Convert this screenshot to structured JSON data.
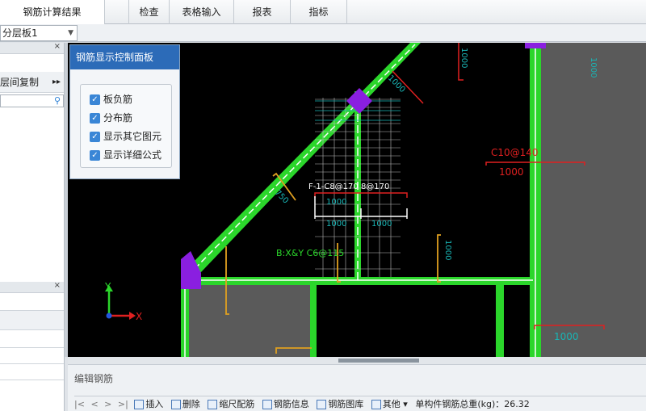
{
  "ribbon": {
    "tabs": [
      {
        "label": "钢筋计算结果"
      },
      {
        "label": "检查"
      },
      {
        "label": "表格输入"
      },
      {
        "label": "报表"
      },
      {
        "label": "指标"
      }
    ]
  },
  "floor_select": {
    "value": "分层板1"
  },
  "left_panel_top": {
    "close": "×",
    "row_label": "层间复制",
    "more": "▸▸",
    "search_icon": "search-icon"
  },
  "left_panel_bottom": {
    "close": "×"
  },
  "control_panel": {
    "title": "钢筋显示控制面板",
    "options": [
      {
        "label": "板负筋",
        "checked": true
      },
      {
        "label": "分布筋",
        "checked": true
      },
      {
        "label": "显示其它图元",
        "checked": true
      },
      {
        "label": "显示详细公式",
        "checked": true
      }
    ]
  },
  "drawing": {
    "labels": {
      "f_rebar": "F-1-C8@170 8@170",
      "b_rebar": "B:X&Y C6@115",
      "c10": "C10@140",
      "dim_1000": "1000",
      "dim_750": "750",
      "axis_y": "Y",
      "axis_x": "X"
    },
    "colors": {
      "wall": "#2bd62b",
      "rebar_red": "#e02020",
      "dim_yellow": "#e0a020",
      "cyan": "#19b5b5",
      "purple": "#8a1fe0",
      "gray_fill": "#5a5a5a"
    }
  },
  "edit_panel": {
    "title": "编辑钢筋",
    "toolbar": [
      {
        "label": "|<",
        "kind": "nav"
      },
      {
        "label": "<",
        "kind": "nav"
      },
      {
        "label": ">",
        "kind": "nav"
      },
      {
        "label": ">|",
        "kind": "nav"
      },
      {
        "label": "插入",
        "kind": "btn"
      },
      {
        "label": "删除",
        "kind": "btn"
      },
      {
        "label": "缩尺配筋",
        "kind": "btn"
      },
      {
        "label": "钢筋信息",
        "kind": "btn"
      },
      {
        "label": "钢筋图库",
        "kind": "btn"
      },
      {
        "label": "其他 ▾",
        "kind": "btn"
      },
      {
        "label": "单构件钢筋总重(kg)：26.32",
        "kind": "text"
      }
    ]
  }
}
